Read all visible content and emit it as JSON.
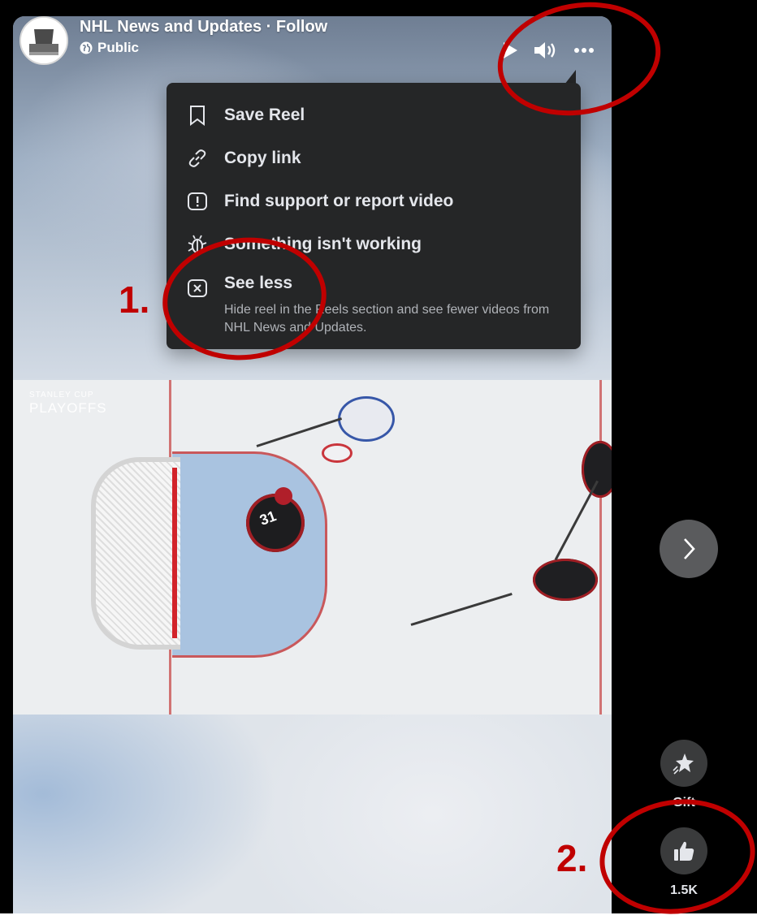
{
  "post": {
    "page_name": "NHL News and Updates · Follow",
    "privacy": "Public"
  },
  "video": {
    "watermark_line1": "STANLEY CUP",
    "watermark_line2": "PLAYOFFS",
    "goalie_number": "31"
  },
  "menu": {
    "items": [
      {
        "label": "Save Reel",
        "icon": "bookmark-icon"
      },
      {
        "label": "Copy link",
        "icon": "link-icon"
      },
      {
        "label": "Find support or report video",
        "icon": "report-icon"
      },
      {
        "label": "Something isn't working",
        "icon": "bug-icon"
      },
      {
        "label": "See less",
        "icon": "close-box-icon",
        "description": "Hide reel in the Reels section and see fewer videos from NHL News and Updates."
      }
    ]
  },
  "sidebar": {
    "gift_label": "Gift",
    "like_count": "1.5K"
  },
  "annotations": {
    "label_1": "1.",
    "label_2": "2.",
    "color": "#c00000"
  },
  "colors": {
    "menu_bg": "#252627",
    "menu_text": "#e4e6eb",
    "secondary_text": "#b0b3b8"
  }
}
